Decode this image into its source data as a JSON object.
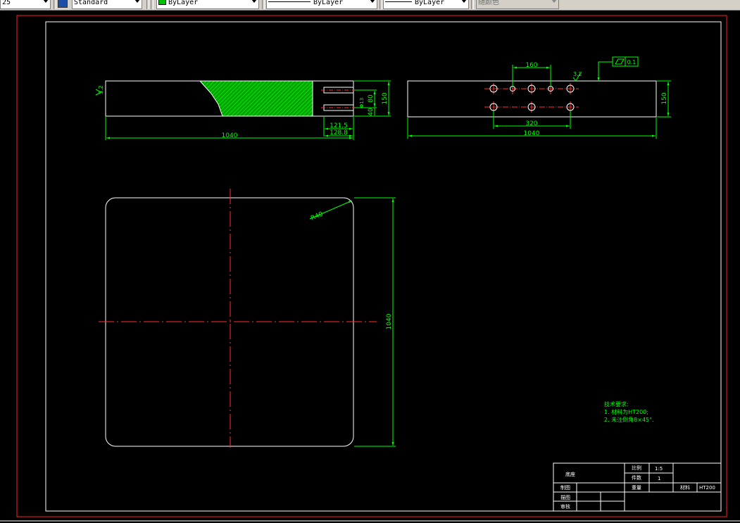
{
  "toolbar": {
    "scale_combo": "25",
    "style_combo": "Standard",
    "color_combo": "ByLayer",
    "linetype_combo": "ByLayer",
    "lineweight_combo": "ByLayer",
    "plotstyle_combo": "随颜色"
  },
  "drawing": {
    "front_view": {
      "dim_length": "1040",
      "dim_height": "150",
      "dim_slot": "80",
      "dim_slot_depth": "40",
      "dim_slot_small": "Φ13",
      "dim_121": "121.5",
      "dim_128": "128.8",
      "roughness_left": "3.2"
    },
    "side_view": {
      "dim_160": "160",
      "dim_320": "320",
      "dim_1040": "1040",
      "dim_150": "150",
      "roughness": "3.2",
      "flatness_value": "0.1"
    },
    "plan_view": {
      "radius_label": "R40",
      "dim_1040": "1040"
    },
    "notes": {
      "title": "技术要求:",
      "line1": "1. 材料为HT200;",
      "line2": "2. 未注倒角8×45°."
    },
    "title_block": {
      "part_name": "底座",
      "scale_label": "比例",
      "scale_value": "1:5",
      "qty_label": "件数",
      "qty_value": "1",
      "drawn_label": "制图",
      "weight_label": "重量",
      "material_label": "材料",
      "material_value": "HT200",
      "checked_label": "描图",
      "approved_label": "审核"
    }
  }
}
